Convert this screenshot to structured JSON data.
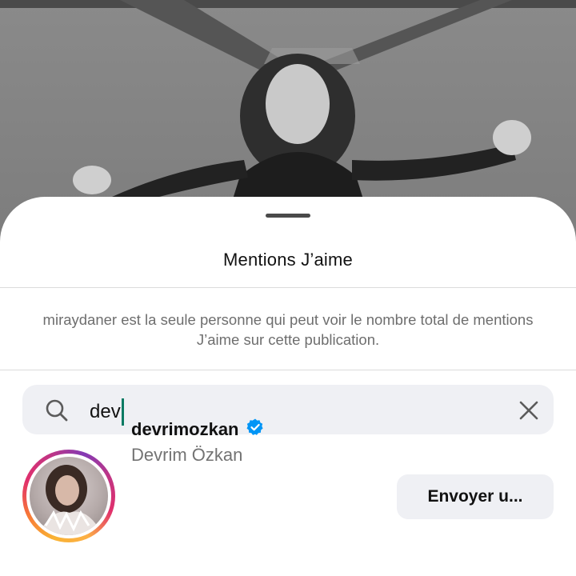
{
  "sheet": {
    "title": "Mentions J’aime",
    "notice": "miraydaner est la seule personne qui peut voir le nombre total de mentions J’aime sur cette publication."
  },
  "search": {
    "query": "dev",
    "search_icon": "search-icon",
    "clear_icon": "close-icon"
  },
  "results": [
    {
      "username": "devrimozkan",
      "full_name": "Devrim Özkan",
      "verified": true,
      "action_label": "Envoyer u..."
    }
  ],
  "colors": {
    "verified_badge": "#0095f6",
    "caret": "#0a7a63",
    "story_ring": [
      "#f9b233",
      "#e1306c",
      "#833ab4"
    ]
  }
}
